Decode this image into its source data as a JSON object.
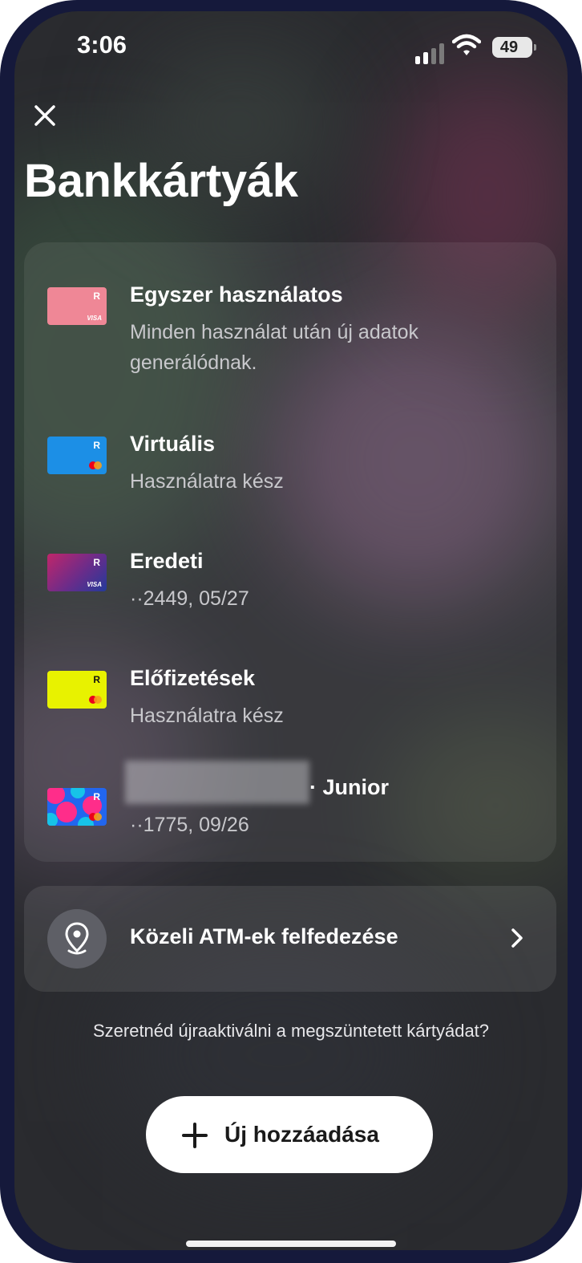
{
  "status_bar": {
    "time": "3:06",
    "battery": "49",
    "icons": [
      "signal-icon",
      "wifi-icon",
      "battery-icon"
    ]
  },
  "header": {
    "close_icon": "close-icon",
    "title": "Bankkártyák"
  },
  "cards": [
    {
      "title": "Egyszer használatos",
      "subtitle": "Minden használat után új adatok generálódnak.",
      "card_letter": "R",
      "network_label": "VISA",
      "card_color": "#ef8796"
    },
    {
      "title": "Virtuális",
      "subtitle": "Használatra kész",
      "card_letter": "R",
      "network": "mastercard",
      "card_color": "#1c8fe6"
    },
    {
      "title": "Eredeti",
      "subtitle": "··2449, 05/27",
      "card_letter": "R",
      "network_label": "VISA",
      "card_color": "#8a2a6a"
    },
    {
      "title": "Előfizetések",
      "subtitle": "Használatra kész",
      "card_letter": "R",
      "network": "mastercard",
      "card_color": "#e8f200"
    },
    {
      "title": "· Junior",
      "subtitle": "··1775, 09/26",
      "card_letter": "R",
      "network": "mastercard",
      "card_color": "#2266ee",
      "name_redacted": true
    }
  ],
  "atm": {
    "label": "Közeli ATM-ek felfedezése",
    "icon": "location-pin-icon",
    "chevron": "chevron-right-icon"
  },
  "reactivate_text": "Szeretnéd újraaktiválni a megszüntetett kártyádat?",
  "add_button": {
    "label": "Új hozzáadása",
    "icon": "plus-icon"
  },
  "colors": {
    "background": "#2a2b2f",
    "device_frame": "#15193b",
    "panel": "rgba(255,255,255,0.07)",
    "text_primary": "#ffffff",
    "text_secondary": "#c8c8cc"
  }
}
